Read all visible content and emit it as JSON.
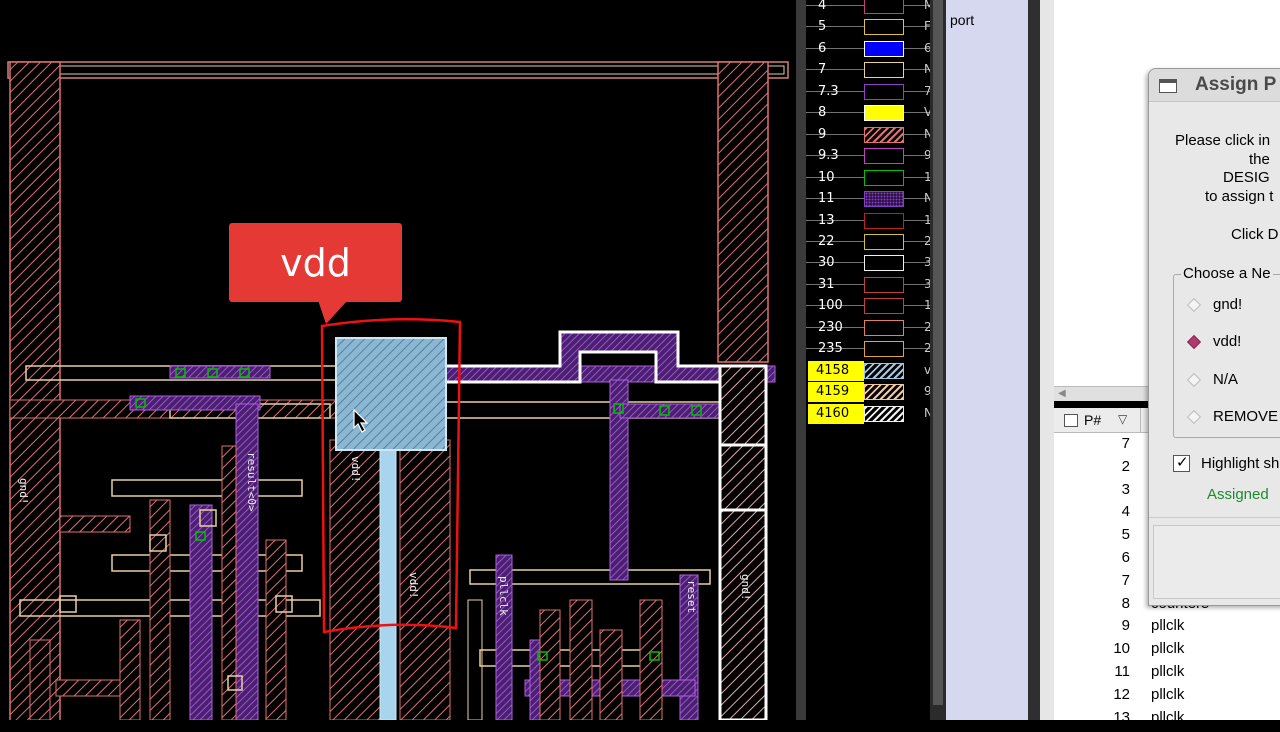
{
  "callout": {
    "label": "vdd"
  },
  "canvas": {
    "net_labels": [
      "gnd!",
      "result<0>",
      "vdd!",
      "vdd!",
      "pllclk",
      "reset",
      "gnd!"
    ]
  },
  "layers": [
    {
      "num": "4",
      "color": "#c04080",
      "style": "outline",
      "suffix": "M",
      "highlight": false
    },
    {
      "num": "5",
      "color": "#e0c040",
      "style": "outline",
      "suffix": "F",
      "highlight": false
    },
    {
      "num": "6",
      "color": "#0000ff",
      "style": "fill",
      "suffix": "6",
      "highlight": false
    },
    {
      "num": "7",
      "color": "#e8d0a0",
      "style": "outline",
      "suffix": "N",
      "highlight": false
    },
    {
      "num": "7.3",
      "color": "#9040c0",
      "style": "outline",
      "suffix": "7",
      "highlight": false
    },
    {
      "num": "8",
      "color": "#ffff00",
      "style": "fill",
      "suffix": "V",
      "highlight": false
    },
    {
      "num": "9",
      "color": "#e07070",
      "style": "hatch",
      "suffix": "N",
      "highlight": false
    },
    {
      "num": "9.3",
      "color": "#c040c0",
      "style": "outline",
      "suffix": "9",
      "highlight": false
    },
    {
      "num": "10",
      "color": "#00c000",
      "style": "outline",
      "suffix": "1",
      "highlight": false
    },
    {
      "num": "11",
      "color": "#8040c0",
      "style": "dots",
      "suffix": "N",
      "highlight": false
    },
    {
      "num": "13",
      "color": "#c02020",
      "style": "outline",
      "suffix": "1",
      "highlight": false
    },
    {
      "num": "22",
      "color": "#d0c040",
      "style": "outline",
      "suffix": "2",
      "highlight": false
    },
    {
      "num": "30",
      "color": "#f0f0f0",
      "style": "outline",
      "suffix": "3",
      "highlight": false
    },
    {
      "num": "31",
      "color": "#c04040",
      "style": "outline",
      "suffix": "3",
      "highlight": false
    },
    {
      "num": "100",
      "color": "#c04040",
      "style": "outline",
      "suffix": "1",
      "highlight": false
    },
    {
      "num": "230",
      "color": "#e08060",
      "style": "outline",
      "suffix": "2",
      "highlight": false
    },
    {
      "num": "235",
      "color": "#e0a040",
      "style": "outline",
      "suffix": "2",
      "highlight": false
    },
    {
      "num": "4158",
      "color": "#a0c8e0",
      "style": "hatch",
      "suffix": "v",
      "highlight": true
    },
    {
      "num": "4159",
      "color": "#f0c8a0",
      "style": "hatch",
      "suffix": "9",
      "highlight": true
    },
    {
      "num": "4160",
      "color": "#f0f0f0",
      "style": "hatch",
      "suffix": "N",
      "highlight": true
    }
  ],
  "support_label": "port",
  "pin_table": {
    "col_pin": "P#",
    "rows": [
      {
        "num": "7",
        "name": ""
      },
      {
        "num": "2",
        "name": ""
      },
      {
        "num": "3",
        "name": ""
      },
      {
        "num": "4",
        "name": ""
      },
      {
        "num": "5",
        "name": ""
      },
      {
        "num": "6",
        "name": ""
      },
      {
        "num": "7",
        "name": ""
      },
      {
        "num": "8",
        "name": "counter5"
      },
      {
        "num": "9",
        "name": "pllclk"
      },
      {
        "num": "10",
        "name": "pllclk"
      },
      {
        "num": "11",
        "name": "pllclk"
      },
      {
        "num": "12",
        "name": "pllclk"
      },
      {
        "num": "13",
        "name": "pllclk"
      }
    ]
  },
  "dialog": {
    "title": "Assign P",
    "instructions": [
      "Please click in",
      "the",
      "DESIG",
      "to assign t"
    ],
    "click_hint": "Click D",
    "group_title": "Choose a Ne",
    "options": [
      {
        "label": "gnd!",
        "selected": false
      },
      {
        "label": "vdd!",
        "selected": true
      },
      {
        "label": "N/A",
        "selected": false
      },
      {
        "label": "REMOVE",
        "selected": false
      }
    ],
    "highlight_label": "Highlight sh",
    "highlight_checked": true,
    "status": "Assigned"
  }
}
